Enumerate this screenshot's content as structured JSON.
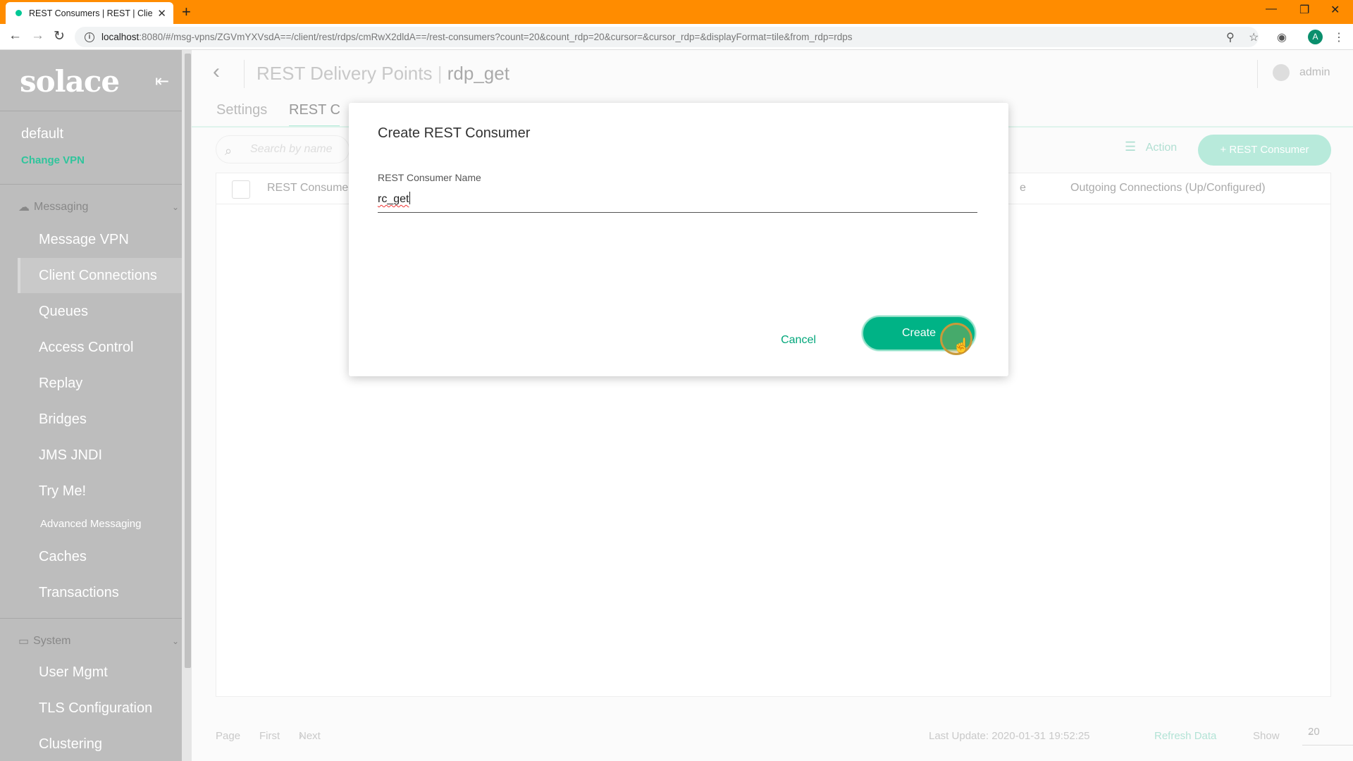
{
  "browser": {
    "tab_title": "REST Consumers | REST | Client C",
    "url_host": "localhost",
    "url_path": ":8080/#/msg-vpns/ZGVmYXVsdA==/client/rest/rdps/cmRwX2dldA==/rest-consumers?count=20&count_rdp=20&cursor=&cursor_rdp=&displayFormat=tile&from_rdp=rdps",
    "profile_initial": "A"
  },
  "sidebar": {
    "logo": "solace",
    "vpn_name": "default",
    "change_vpn": "Change VPN",
    "messaging_section": "Messaging",
    "items": [
      {
        "label": "Message VPN"
      },
      {
        "label": "Client Connections"
      },
      {
        "label": "Queues"
      },
      {
        "label": "Access Control"
      },
      {
        "label": "Replay"
      },
      {
        "label": "Bridges"
      },
      {
        "label": "JMS JNDI"
      },
      {
        "label": "Try Me!"
      },
      {
        "label": "Advanced Messaging"
      },
      {
        "label": "Caches"
      },
      {
        "label": "Transactions"
      }
    ],
    "system_section": "System",
    "system_items": [
      {
        "label": "User Mgmt"
      },
      {
        "label": "TLS Configuration"
      },
      {
        "label": "Clustering"
      }
    ]
  },
  "main": {
    "breadcrumb_parent": "REST Delivery Points",
    "breadcrumb_current": "rdp_get",
    "user": "admin",
    "tabs": [
      {
        "label": "Settings"
      },
      {
        "label": "REST C"
      }
    ],
    "search_placeholder": "Search by name",
    "action_label": "Action",
    "add_button": "+ REST Consumer",
    "columns": {
      "name": "REST Consume",
      "partial": "e",
      "outgoing": "Outgoing Connections (Up/Configured)"
    },
    "footer": {
      "page": "Page",
      "first": "First",
      "next": "Next",
      "last_update": "Last Update: 2020-01-31 19:52:25",
      "refresh": "Refresh Data",
      "show": "Show",
      "page_size": "20"
    }
  },
  "dialog": {
    "title": "Create REST Consumer",
    "field_label": "REST Consumer Name",
    "field_value": "rc_get",
    "cancel": "Cancel",
    "create": "Create"
  }
}
